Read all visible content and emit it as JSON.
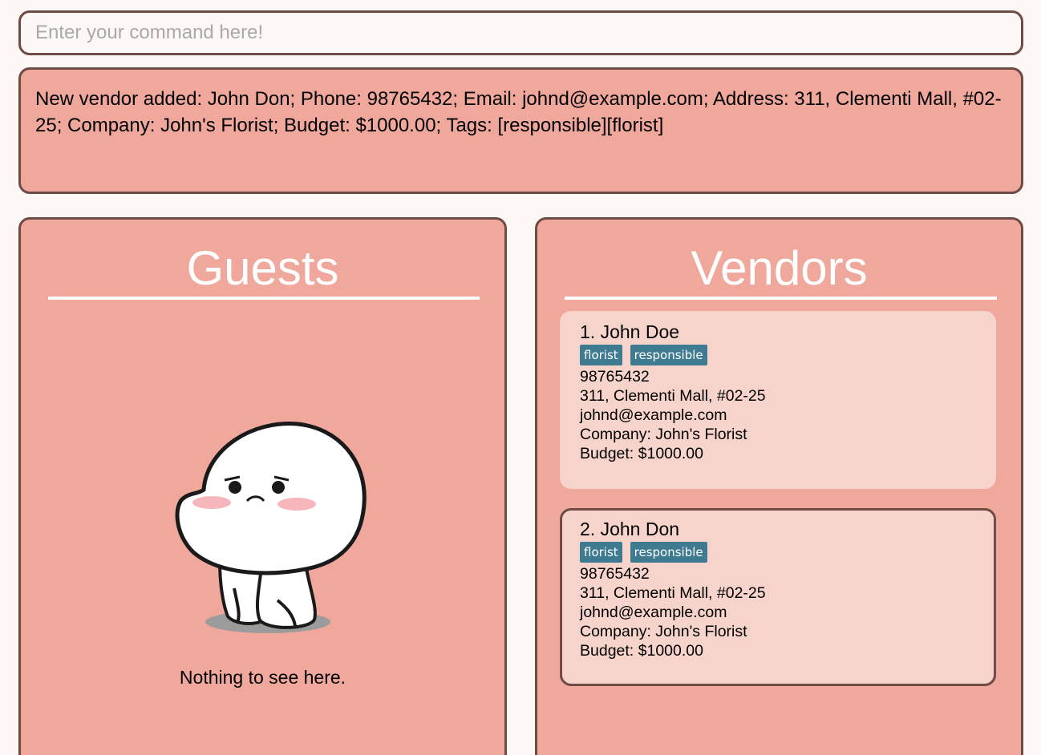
{
  "command": {
    "placeholder": "Enter your command here!",
    "value": ""
  },
  "result": {
    "message": "New vendor added: John Don; Phone: 98765432; Email: johnd@example.com; Address: 311, Clementi Mall, #02-25; Company: John's Florist; Budget: $1000.00; Tags: [responsible][florist]"
  },
  "guests": {
    "title": "Guests",
    "empty_text": "Nothing to see here."
  },
  "vendors": {
    "title": "Vendors",
    "items": [
      {
        "name": "1. John Doe",
        "tags": [
          "florist",
          "responsible"
        ],
        "phone": "98765432",
        "address": "311, Clementi Mall, #02-25",
        "email": "johnd@example.com",
        "company": "Company: John's Florist",
        "budget": "Budget: $1000.00"
      },
      {
        "name": "2. John Don",
        "tags": [
          "florist",
          "responsible"
        ],
        "phone": "98765432",
        "address": "311, Clementi Mall, #02-25",
        "email": "johnd@example.com",
        "company": "Company: John's Florist",
        "budget": "Budget: $1000.00"
      }
    ]
  },
  "colors": {
    "panel": "#f0a79c",
    "card": "#f7d4cb",
    "tag": "#3e7b91",
    "border": "#6e4b45"
  }
}
